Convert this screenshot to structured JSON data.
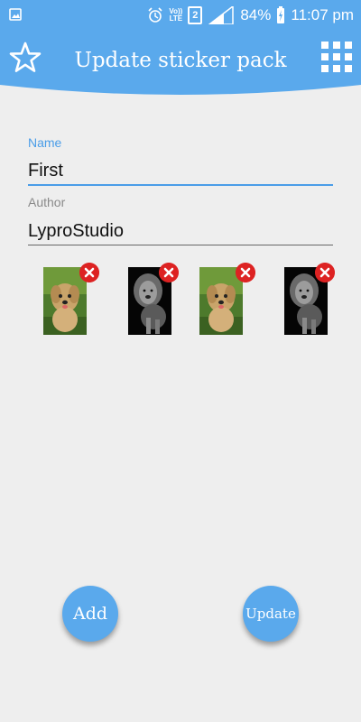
{
  "status_bar": {
    "battery": "84%",
    "time": "11:07 pm",
    "volte_top": "Vo))",
    "volte_bottom": "LTE",
    "sim": "2"
  },
  "header": {
    "title": "Update sticker pack",
    "color": "#5aa9ec"
  },
  "form": {
    "name_label": "Name",
    "name_value": "First",
    "author_label": "Author",
    "author_value": "LyproStudio"
  },
  "stickers": [
    {
      "icon": "dog-sticker-image"
    },
    {
      "icon": "lion-sticker-image"
    },
    {
      "icon": "dog-sticker-image"
    },
    {
      "icon": "lion-sticker-image"
    }
  ],
  "actions": {
    "add_label": "Add",
    "update_label": "Update"
  }
}
